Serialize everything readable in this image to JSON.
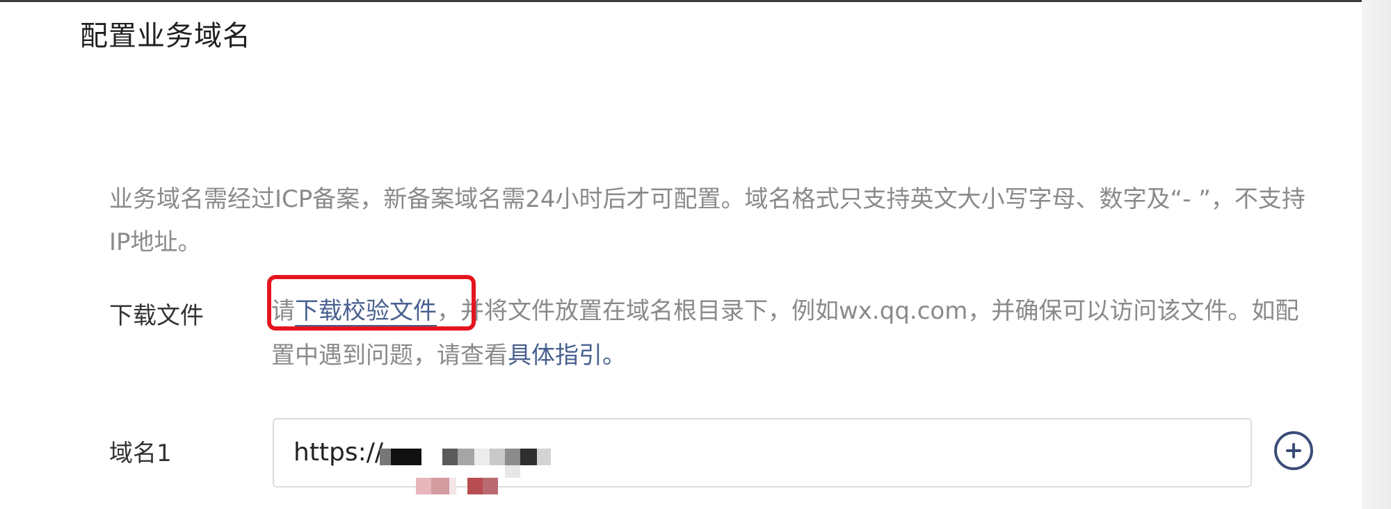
{
  "page": {
    "title": "配置业务域名"
  },
  "notice": {
    "text": "业务域名需经过ICP备案，新备案域名需24小时后才可配置。域名格式只支持英文大小写字母、数字及“- ”，不支持IP地址。"
  },
  "download": {
    "label": "下载文件",
    "prefix": "请",
    "link_text": "下载校验文件",
    "text_after_link": "，并将文件放置在域名根目录下，例如wx.qq.com，并确保可以访问该文件。如配置中遇到问题，请查看",
    "guide_link_text": "具体指引",
    "end_punct": "。"
  },
  "domains": [
    {
      "label": "域名1",
      "value": "https://"
    }
  ],
  "icons": {
    "add": "plus-circle-icon"
  },
  "colors": {
    "link": "#48608f",
    "highlight": "#e5141f",
    "accent_icon": "#3b4c78"
  }
}
